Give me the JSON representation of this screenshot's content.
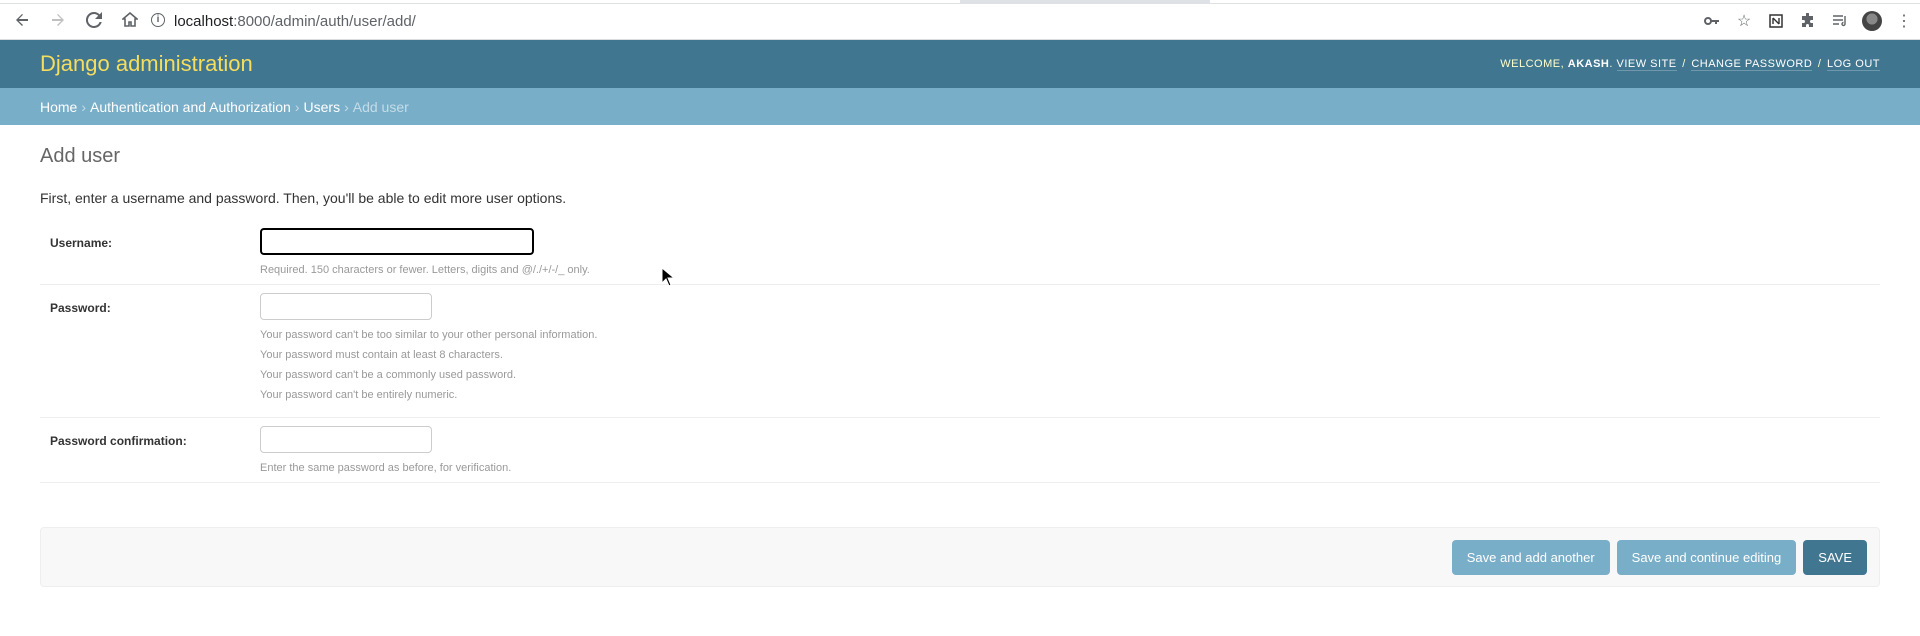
{
  "browser": {
    "url_host": "localhost",
    "url_path": ":8000/admin/auth/user/add/"
  },
  "header": {
    "branding": "Django administration",
    "welcome": "Welcome,",
    "username": "Akash",
    "view_site": "View site",
    "change_password": "Change password",
    "log_out": "Log out"
  },
  "breadcrumbs": {
    "home": "Home",
    "app": "Authentication and Authorization",
    "model": "Users",
    "current": "Add user",
    "sep": "›"
  },
  "content": {
    "title": "Add user",
    "intro": "First, enter a username and password. Then, you'll be able to edit more user options."
  },
  "form": {
    "username": {
      "label": "Username:",
      "value": "",
      "help": "Required. 150 characters or fewer. Letters, digits and @/./+/-/_ only."
    },
    "password": {
      "label": "Password:",
      "value": "",
      "help": [
        "Your password can't be too similar to your other personal information.",
        "Your password must contain at least 8 characters.",
        "Your password can't be a commonly used password.",
        "Your password can't be entirely numeric."
      ]
    },
    "password_confirmation": {
      "label": "Password confirmation:",
      "value": "",
      "help": "Enter the same password as before, for verification."
    }
  },
  "submit": {
    "save_add_another": "Save and add another",
    "save_continue": "Save and continue editing",
    "save": "Save"
  },
  "colors": {
    "header_bg": "#417690",
    "breadcrumbs_bg": "#79aec8",
    "branding": "#f5dd5d"
  }
}
